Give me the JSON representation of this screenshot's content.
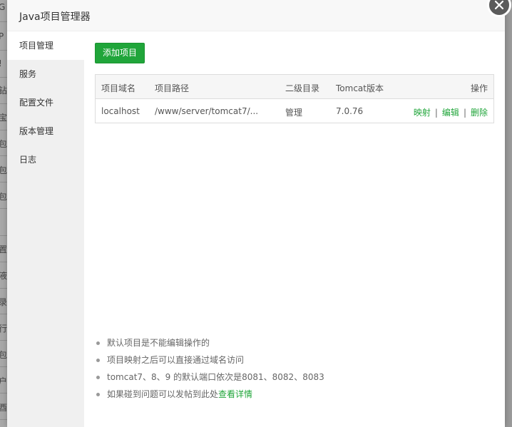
{
  "window": {
    "title": "Java项目管理器"
  },
  "sidebar": {
    "items": [
      {
        "label": "项目管理",
        "active": true
      },
      {
        "label": "服务",
        "active": false
      },
      {
        "label": "配置文件",
        "active": false
      },
      {
        "label": "版本管理",
        "active": false
      },
      {
        "label": "日志",
        "active": false
      }
    ]
  },
  "toolbar": {
    "add_label": "添加项目"
  },
  "table": {
    "headers": [
      "项目域名",
      "项目路径",
      "二级目录",
      "Tomcat版本",
      "操作"
    ],
    "rows": [
      {
        "domain": "localhost",
        "path": "/www/server/tomcat7/...",
        "subdir": "管理",
        "version": "7.0.76",
        "actions": {
          "map": "映射",
          "edit": "编辑",
          "delete": "删除",
          "sep": "|"
        }
      }
    ]
  },
  "notes": [
    "默认项目是不能编辑操作的",
    "项目映射之后可以直接通过域名访问",
    "tomcat7、8、9 的默认端口依次是8081、8082、8083",
    {
      "text": "如果碰到问题可以发帖到此处",
      "link": "查看详情"
    }
  ],
  "background": {
    "chars": [
      "G",
      "P",
      "!",
      "钻",
      "宝",
      "包",
      "包",
      "包",
      "置",
      "液",
      "录",
      "行",
      "包",
      "户",
      "酉"
    ]
  },
  "colors": {
    "accent": "#20a53a",
    "sidebar_bg": "#f0f0f0",
    "close_bg": "#5b5b5b"
  },
  "icons": {
    "close": "close-icon",
    "bullet": "bullet-icon"
  }
}
